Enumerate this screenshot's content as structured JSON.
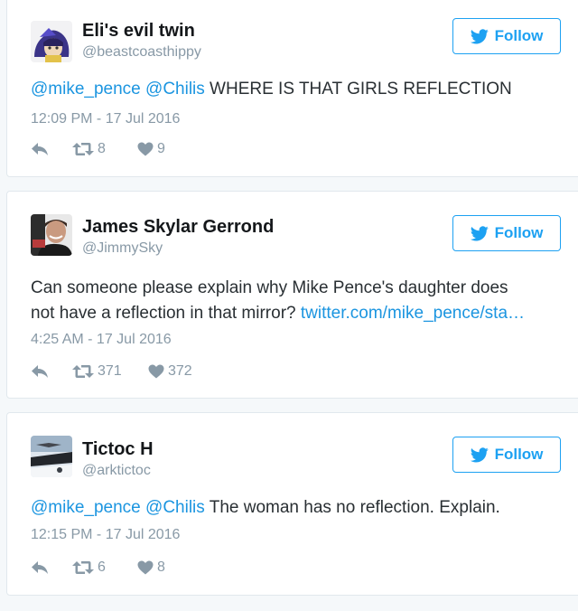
{
  "follow_label": "Follow",
  "tweets": [
    {
      "name": "Eli's evil twin",
      "handle": "@beastcoasthippy",
      "text_parts": [
        "@mike_pence",
        " ",
        "@Chilis",
        " WHERE IS THAT GIRLS REFLECTION"
      ],
      "timestamp": "12:09 PM - 17 Jul 2016",
      "retweets": "8",
      "likes": "9"
    },
    {
      "name": "James Skylar Gerrond",
      "handle": "@JimmySky",
      "text_line1": "Can someone please explain why Mike Pence's daughter does",
      "text_line2": "not have a reflection in that mirror? ",
      "text_link": "twitter.com/mike_pence/sta…",
      "timestamp": "4:25 AM - 17 Jul 2016",
      "retweets": "371",
      "likes": "372"
    },
    {
      "name": "Tictoc H",
      "handle": "@arktictoc",
      "text_parts": [
        "@mike_pence",
        " ",
        "@Chilis",
        " The woman has no reflection. Explain."
      ],
      "timestamp": "12:15 PM - 17 Jul 2016",
      "retweets": "6",
      "likes": "8"
    }
  ],
  "icons": {
    "bird": "twitter-bird-icon",
    "reply": "reply-arrow-icon",
    "retweet": "retweet-icon",
    "like": "heart-icon"
  },
  "colors": {
    "accent": "#1da1f2",
    "link": "#1b95e0",
    "muted": "#8899a6",
    "text": "#292f33",
    "border": "#e1e8ed",
    "background": "#f5f8fa"
  }
}
